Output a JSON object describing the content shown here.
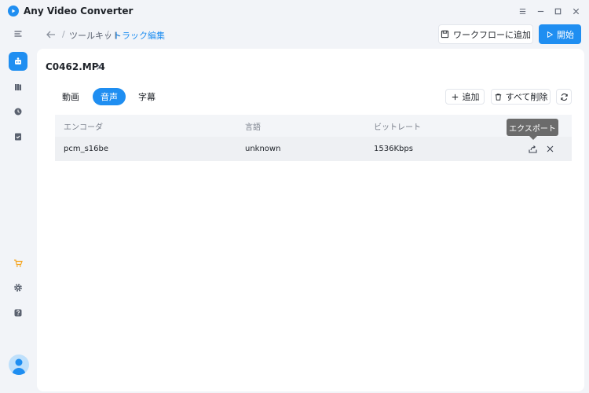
{
  "app": {
    "title": "Any Video Converter",
    "accent_color": "#1f8ef1",
    "window_controls": [
      "menu-icon",
      "minimize-icon",
      "maximize-icon",
      "close-icon"
    ]
  },
  "sidebar": {
    "items": [
      {
        "icon": "collapse-menu-icon"
      },
      {
        "icon": "toolkit-icon",
        "active": true
      },
      {
        "icon": "library-icon"
      },
      {
        "icon": "history-icon"
      },
      {
        "icon": "tasks-icon"
      },
      {
        "icon": "cart-icon"
      },
      {
        "icon": "settings-icon"
      },
      {
        "icon": "help-icon"
      },
      {
        "icon": "user-avatar-icon"
      }
    ]
  },
  "breadcrumb": {
    "sep": "/",
    "items": [
      "ツールキット",
      "トラック編集"
    ]
  },
  "header": {
    "workflow_label": "ワークフローに追加",
    "start_label": "開始"
  },
  "file": {
    "name": "C0462.MP4"
  },
  "tabs": [
    {
      "label": "動画",
      "active": false
    },
    {
      "label": "音声",
      "active": true
    },
    {
      "label": "字幕",
      "active": false
    }
  ],
  "toolbar": {
    "add_label": "追加",
    "delete_all_label": "すべて削除"
  },
  "table": {
    "columns": [
      "エンコーダ",
      "言語",
      "ビットレート"
    ],
    "rows": [
      {
        "encoder": "pcm_s16be",
        "language": "unknown",
        "bitrate": "1536Kbps"
      }
    ]
  },
  "tooltip": {
    "text": "エクスポート"
  }
}
